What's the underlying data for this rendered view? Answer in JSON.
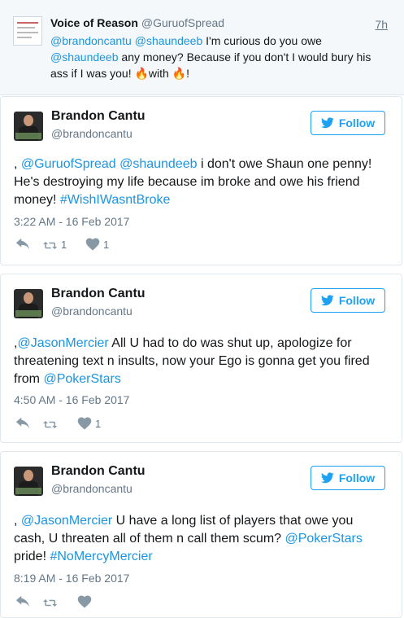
{
  "quoted_tweet": {
    "name": "Voice of Reason",
    "handle": "@GuruofSpread",
    "time": "7h",
    "text_parts": {
      "m1": "@brandoncantu",
      "m2": "@shaundeeb",
      "t1": " I'm curious do you owe ",
      "m3": "@shaundeeb",
      "t2": " any money? Because if you don't I would bury his ass if I was you! ",
      "fire1": "🔥",
      "t3": "with ",
      "fire2": "🔥",
      "t4": "!"
    }
  },
  "tweets": [
    {
      "name": "Brandon Cantu",
      "handle": "@brandoncantu",
      "follow_label": "Follow",
      "text_parts": {
        "t0": ", ",
        "m1": "@GuruofSpread",
        "sp": " ",
        "m2": "@shaundeeb",
        "t1": " i don't owe Shaun one penny! He's destroying my life because im broke and owe his friend money! ",
        "h1": "#WishIWasntBroke"
      },
      "timestamp": "3:22 AM - 16 Feb 2017",
      "retweets": "1",
      "likes": "1"
    },
    {
      "name": "Brandon Cantu",
      "handle": "@brandoncantu",
      "follow_label": "Follow",
      "text_parts": {
        "t0": ",",
        "m1": "@JasonMercier",
        "t1": " All U had to do was shut up, apologize for threatening text n insults, now your Ego is gonna get you fired from ",
        "m2": "@PokerStars"
      },
      "timestamp": "4:50 AM - 16 Feb 2017",
      "retweets": "",
      "likes": "1"
    },
    {
      "name": "Brandon Cantu",
      "handle": "@brandoncantu",
      "follow_label": "Follow",
      "text_parts": {
        "t0": ", ",
        "m1": "@JasonMercier",
        "t1": " U have a long list of players that owe you cash, U threaten all of them n call them scum? ",
        "m2": "@PokerStars",
        "t2": " pride! ",
        "h1": "#NoMercyMercier"
      },
      "timestamp": "8:19 AM - 16 Feb 2017",
      "retweets": "",
      "likes": ""
    }
  ],
  "icons": {
    "reply": "reply-icon",
    "retweet": "retweet-icon",
    "like": "heart-icon",
    "follow": "twitter-bird-icon"
  },
  "colors": {
    "link": "#1b95e0",
    "follow_blue": "#1da1f2",
    "muted": "#657786",
    "quoted_bg": "#f5f8fa"
  }
}
